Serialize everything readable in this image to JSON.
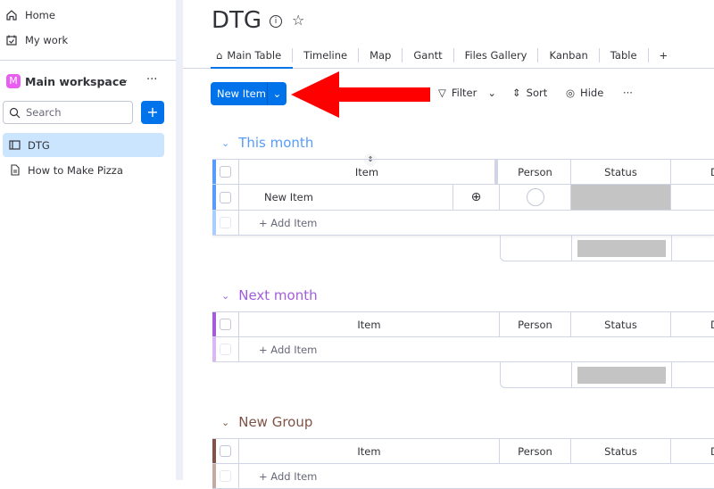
{
  "sidebar": {
    "nav": [
      {
        "label": "Home",
        "icon": "home-icon"
      },
      {
        "label": "My work",
        "icon": "calendar-check-icon"
      }
    ],
    "workspace": {
      "logo_letter": "M",
      "name": "Main workspace",
      "logo_color": "#e85ef0"
    },
    "search": {
      "placeholder": "Search"
    },
    "add_label": "+",
    "boards": [
      {
        "label": "DTG",
        "selected": true,
        "icon": "board-icon"
      },
      {
        "label": "How to Make Pizza",
        "icon": "document-icon"
      }
    ]
  },
  "board": {
    "title": "DTG",
    "tabs": [
      "Main Table",
      "Timeline",
      "Map",
      "Gantt",
      "Files Gallery",
      "Kanban",
      "Table",
      "+"
    ],
    "active_tab": "Main Table",
    "toolbar": {
      "new_item": "New Item",
      "filter": "Filter",
      "sort": "Sort",
      "hide": "Hide",
      "more": "···"
    },
    "accent": "#0073ea",
    "annotation_arrow_color": "#ff0000"
  },
  "columns": {
    "item": "Item",
    "person": "Person",
    "status": "Status",
    "date": "D"
  },
  "groups": [
    {
      "name": "This month",
      "color": "#579bfc",
      "items": [
        "New Item"
      ],
      "add": "+ Add Item"
    },
    {
      "name": "Next month",
      "color": "#a25ddc",
      "items": [],
      "add": "+ Add Item"
    },
    {
      "name": "New Group",
      "color": "#7f5347",
      "items": [],
      "add": "+ Add Item"
    }
  ]
}
